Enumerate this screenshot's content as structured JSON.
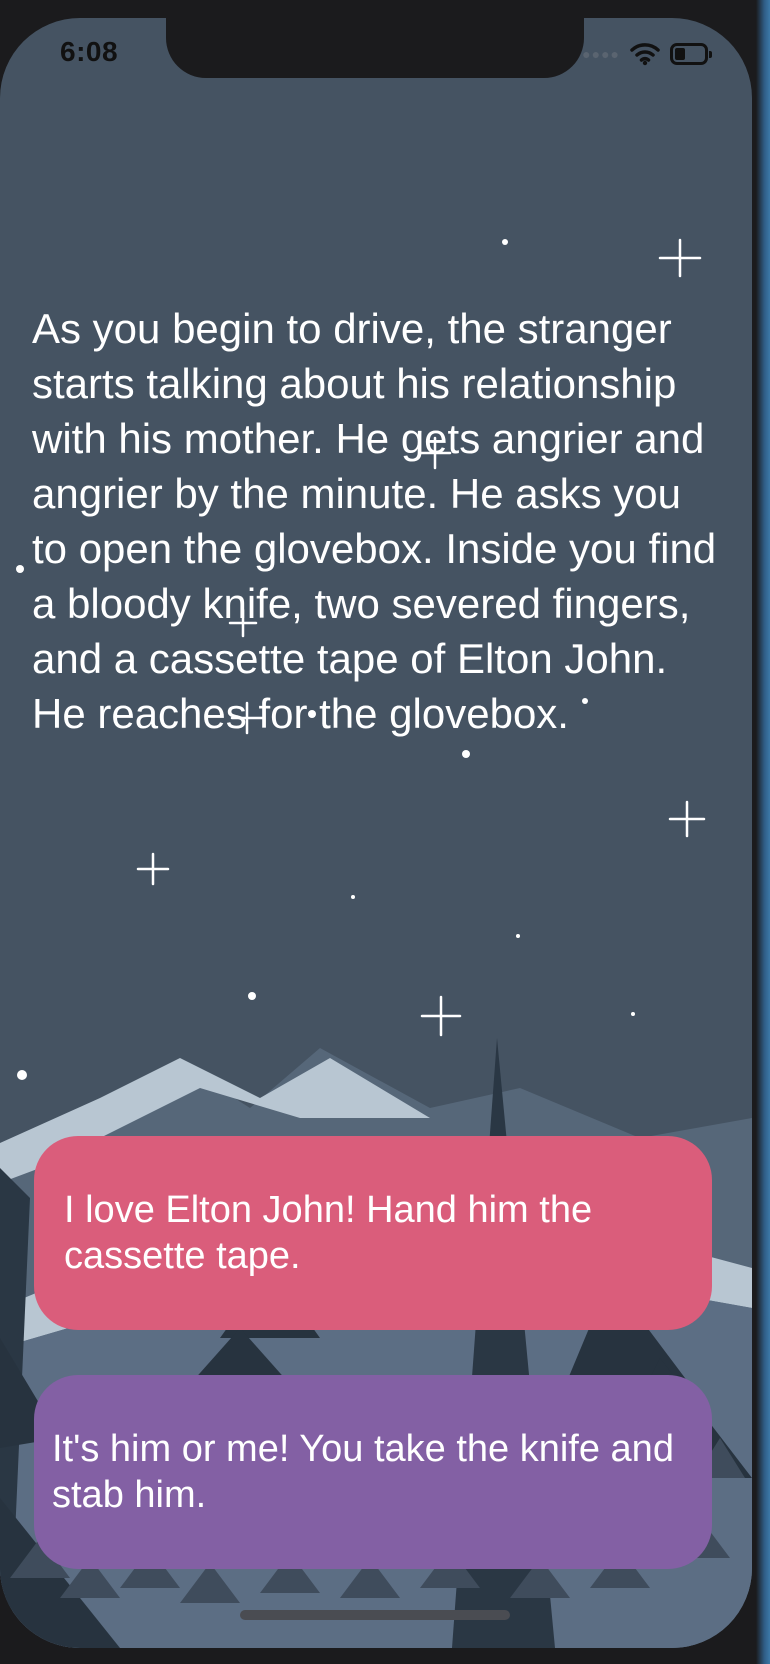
{
  "status_bar": {
    "time": "6:08",
    "signal_icon": "signal-dots-icon",
    "wifi_icon": "wifi-icon",
    "battery_icon": "battery-icon",
    "battery_level": 0.35
  },
  "story": {
    "text": "As you begin to drive, the stranger starts talking about his relationship with his mother. He gets angrier and angrier by the minute. He asks you to open the glovebox. Inside you find a bloody knife, two severed fingers, and a cassette tape of Elton John. He reaches for the glovebox."
  },
  "choices": [
    {
      "label": "I love Elton John! Hand him the cassette tape.",
      "color": "#da5d7b"
    },
    {
      "label": "It's him or me! You take the knife and stab him.",
      "color": "#8360a4"
    }
  ],
  "colors": {
    "sky": "#455362",
    "mountain_far": "#5a6b80",
    "snow": "#b9c8d4",
    "trees_dark": "#26323e",
    "text": "#ffffff"
  }
}
